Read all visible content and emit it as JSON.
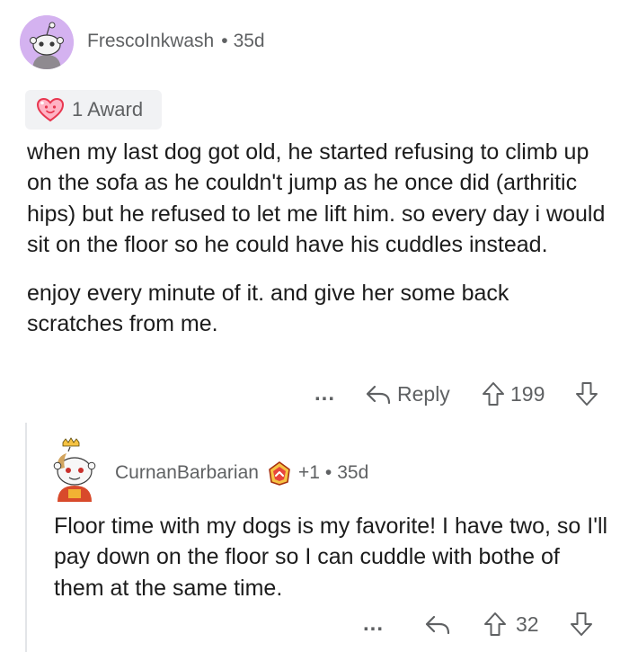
{
  "comment": {
    "username": "FrescoInkwash",
    "separator": "•",
    "age": "35d",
    "award_label": "1 Award",
    "paragraphs": [
      "when my last dog got old, he started refusing to climb up on the sofa as he couldn't jump as he once did (arthritic hips) but he refused to let me lift him. so every day i would sit on the floor so he could have his cuddles instead.",
      "enjoy every minute of it. and give her some back scratches from me."
    ],
    "more": "...",
    "reply_label": "Reply",
    "score": "199",
    "icons": {
      "avatar": "snoo-avatar-icon",
      "award": "heart-award-icon",
      "reply": "reply-arrow-icon",
      "upvote": "upvote-icon",
      "downvote": "downvote-icon"
    }
  },
  "reply": {
    "username": "CurnanBarbarian",
    "karma_badge": "+1",
    "separator": "•",
    "age": "35d",
    "paragraphs": [
      "Floor time with my dogs is my favorite! I have two, so I'll pay down on the floor so I can cuddle with bothe of them at the same time."
    ],
    "more": "...",
    "score": "32",
    "icons": {
      "avatar": "snoo-avatar-icon",
      "flair": "crown-flair-icon",
      "reply": "reply-arrow-icon",
      "upvote": "upvote-icon",
      "downvote": "downvote-icon"
    }
  },
  "colors": {
    "meta_text": "#5f6163",
    "body_text": "#1c1c1c",
    "avatar1_bg": "#d4b2f0",
    "award_bg": "#f1f2f4",
    "thread_line": "#e3e5e8"
  }
}
